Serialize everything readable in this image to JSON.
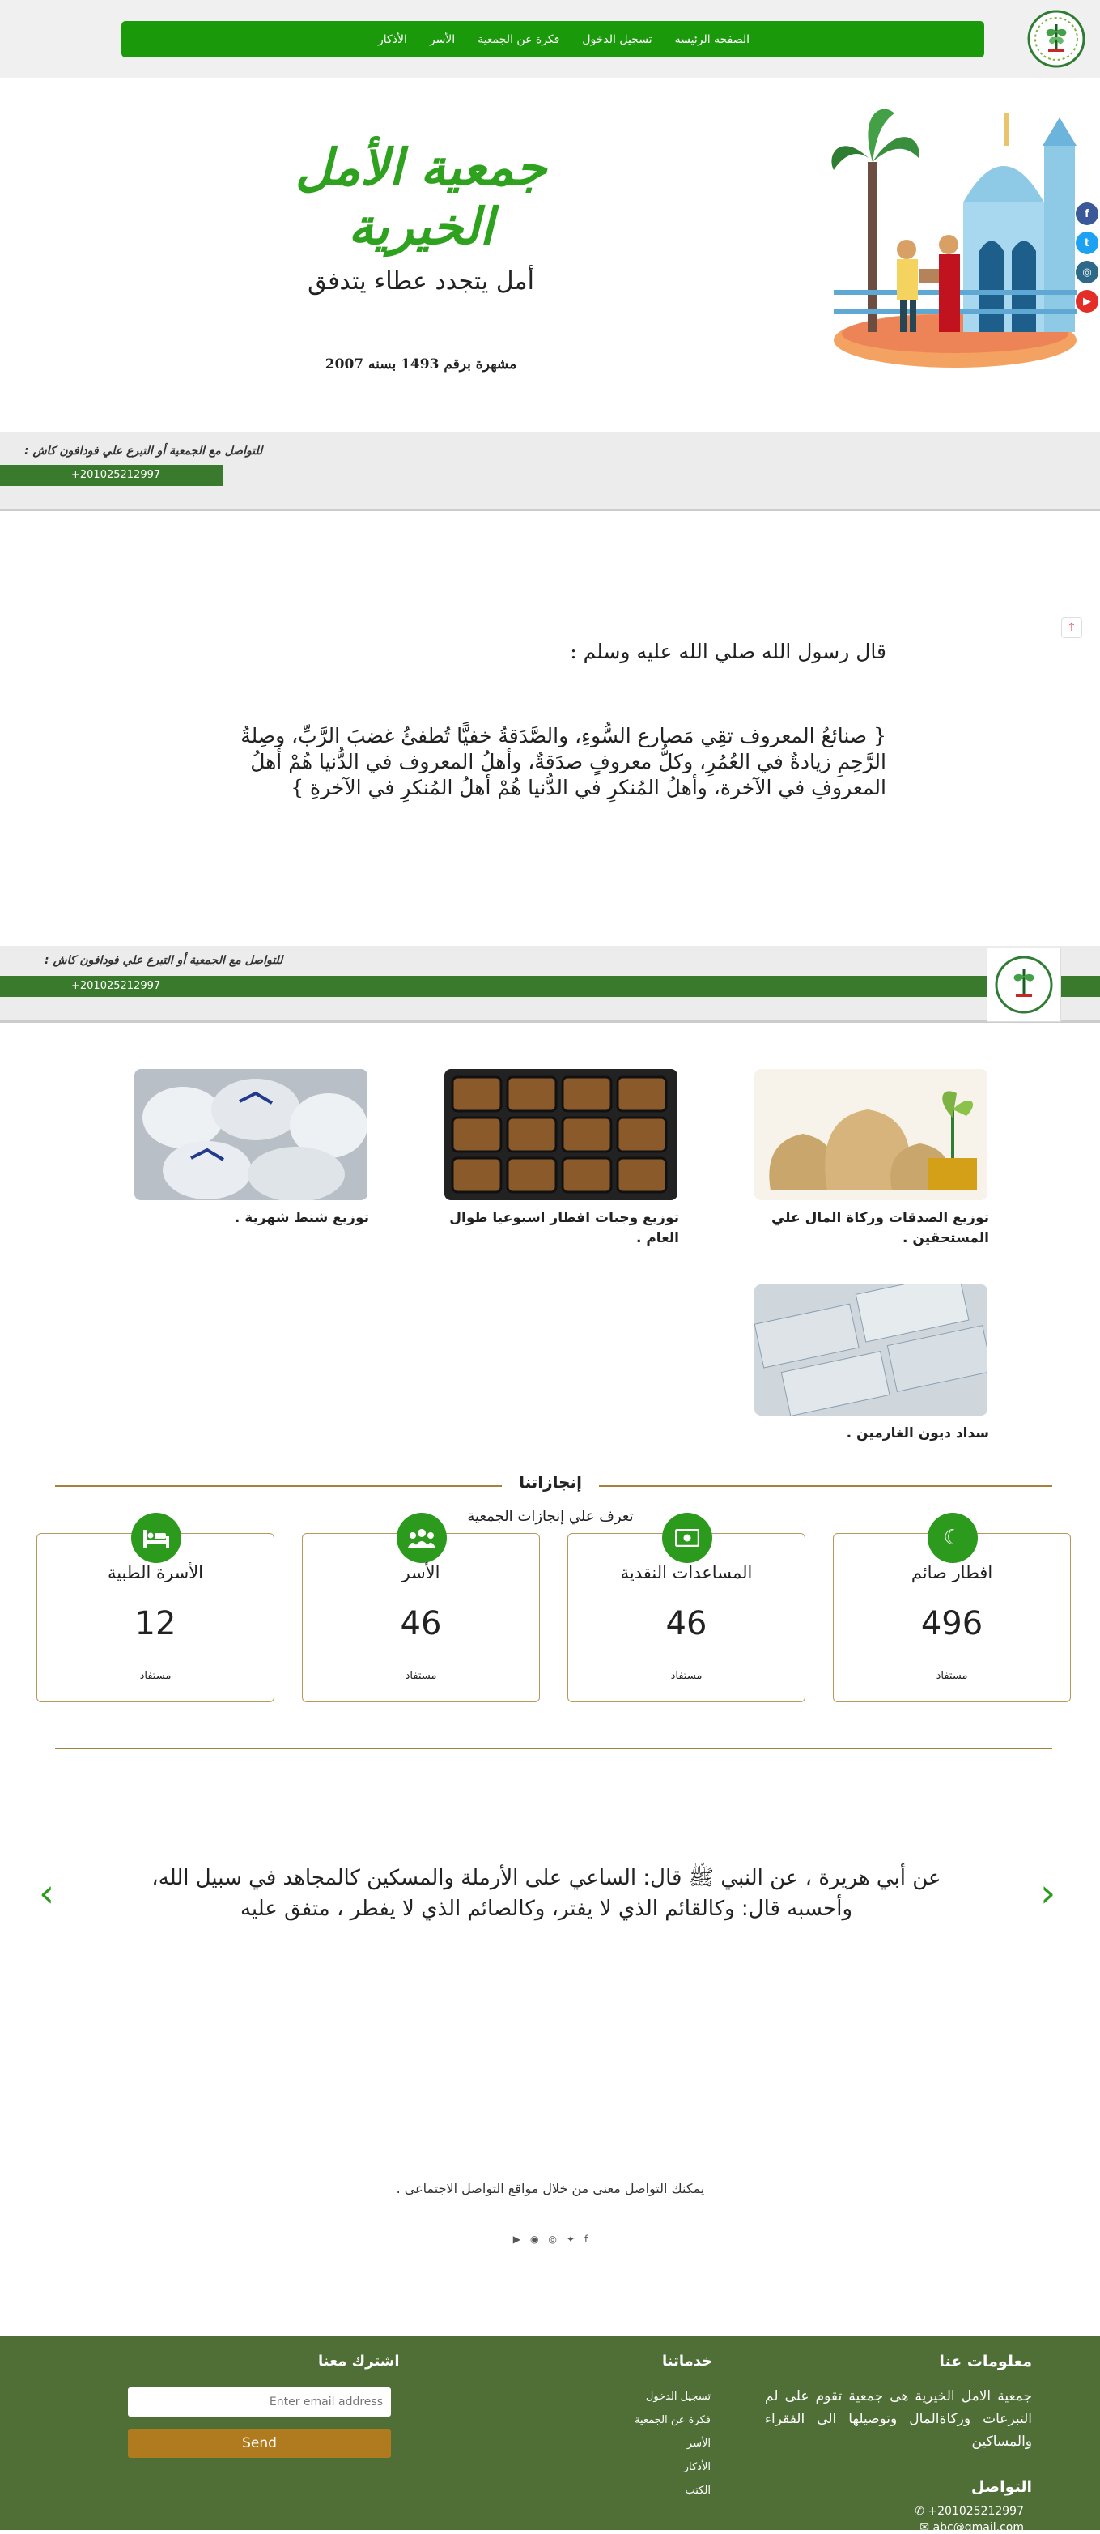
{
  "nav": {
    "items": [
      "الصفحه الرئيسه",
      "تسجيل الدخول",
      "فكرة عن الجمعية",
      "الأسر",
      "الأذكار"
    ]
  },
  "hero": {
    "title": "جمعية الأمل الخيرية",
    "subtitle": "أمل يتجدد عطاء يتدفق",
    "registration": "مشهرة برقم 1493 بسنه 2007"
  },
  "strip": {
    "label": "للتواصل مع الجمعية أو التبرع علي فودافون كاش :",
    "phone": "+201025212997"
  },
  "hadith": {
    "intro": "قال رسول الله صلي الله عليه وسلم :",
    "text": "{ صنائعُ المعروف تقِي مَصارع السُّوءِ، والصَّدَقةُ خفيًّا تُطفئُ غضبَ الرَّبِّ، وصِلةُ الرَّحِمِ زيادةٌ في العُمُرِ، وكلُّ معروفٍ صدَقةٌ، وأهلُ المعروف في الدُّنيا هُمْ أهلُ المعروفِ في الآخرة، وأهلُ المُنكرِ في الدُّنيا هُمْ أهلُ المُنكرِ في الآخرةِ }"
  },
  "services": [
    {
      "caption": "توزيع الصدقات وزكاة المال علي المستحقين ."
    },
    {
      "caption": "توزيع وجبات افطار اسبوعيا طوال العام ."
    },
    {
      "caption": "توزيع شنط شهرية ."
    },
    {
      "caption": "سداد ديون الغارمين ."
    }
  ],
  "achievements": {
    "title": "إنجازاتنا",
    "subtitle": "تعرف علي إنجازات الجمعية",
    "cards": [
      {
        "title": "افطار صائم",
        "number": "496",
        "unit": "مستفاد",
        "icon": "moon-icon"
      },
      {
        "title": "المساعدات النقدية",
        "number": "46",
        "unit": "مستفاد",
        "icon": "money-icon"
      },
      {
        "title": "الأسر",
        "number": "46",
        "unit": "مستفاد",
        "icon": "people-icon"
      },
      {
        "title": "الأسرة الطبية",
        "number": "12",
        "unit": "مستفاد",
        "icon": "bed-icon"
      }
    ]
  },
  "slider": {
    "text": "عن أبي هريرة ، عن النبي ﷺ قال: الساعي على الأرملة والمسكين كالمجاهد في سبيل الله، وأحسبه قال: وكالقائم الذي لا يفتر، وكالصائم الذي لا يفطر ، متفق عليه"
  },
  "social": {
    "text": "يمكنك التواصل معنى من خلال مواقع التواصل الاجتماعى ."
  },
  "footer": {
    "about_title": "معلومات عنا",
    "about_text": "جمعية الامل الخيرية هى جمعية تقوم على لم التبرعات وزكاةالمال وتوصيلها الى الفقراء والمساكين",
    "contact_title": "التواصل",
    "phone": "+201025212997",
    "email": "abc@gmail.com",
    "services_title": "خدماتنا",
    "services_links": [
      "تسجيل الدخول",
      "فكرة عن الجمعية",
      "الأسر",
      "الأذكار",
      "الكتب"
    ],
    "subscribe_title": "اشترك معنا",
    "email_placeholder": "Enter email address",
    "send_label": "Send"
  },
  "colors": {
    "brand_green": "#1a9a0a",
    "footer_green": "#4f6f37",
    "gold": "#a5813c",
    "send_button": "#b07a1e"
  }
}
